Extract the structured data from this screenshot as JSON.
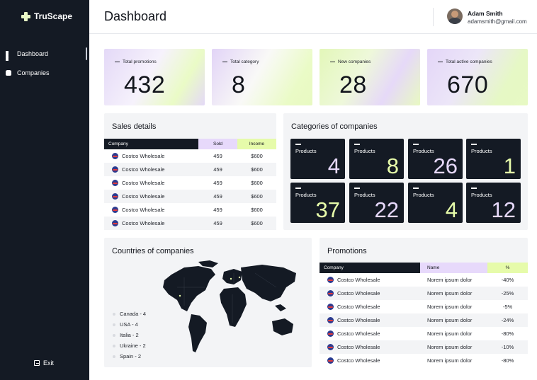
{
  "app": {
    "name": "TruScape"
  },
  "sidebar": {
    "items": [
      {
        "label": "Dashboard",
        "icon": "grid-icon"
      },
      {
        "label": "Companies",
        "icon": "database-icon"
      }
    ],
    "exit_label": "Exit"
  },
  "header": {
    "title": "Dashboard",
    "user": {
      "name": "Adam Smith",
      "email": "adamsmith@gmail.com"
    }
  },
  "stats": [
    {
      "label": "Total promotions",
      "value": "432"
    },
    {
      "label": "Total category",
      "value": "8"
    },
    {
      "label": "New companies",
      "value": "28"
    },
    {
      "label": "Total active companies",
      "value": "670"
    }
  ],
  "sales": {
    "title": "Sales details",
    "columns": [
      "Company",
      "Sold",
      "Income"
    ],
    "rows": [
      {
        "company": "Costco Wholesale",
        "sold": "459",
        "income": "$600"
      },
      {
        "company": "Costco Wholesale",
        "sold": "459",
        "income": "$600"
      },
      {
        "company": "Costco Wholesale",
        "sold": "459",
        "income": "$600"
      },
      {
        "company": "Costco Wholesale",
        "sold": "459",
        "income": "$600"
      },
      {
        "company": "Costco Wholesale",
        "sold": "459",
        "income": "$600"
      },
      {
        "company": "Costco Wholesale",
        "sold": "459",
        "income": "$600"
      }
    ]
  },
  "categories": {
    "title": "Categories of companies",
    "tiles": [
      {
        "label": "Products",
        "value": "4",
        "color": "#e7d9fb"
      },
      {
        "label": "Products",
        "value": "8",
        "color": "#e6fbaa"
      },
      {
        "label": "Products",
        "value": "26",
        "color": "#e7d9fb"
      },
      {
        "label": "Products",
        "value": "1",
        "color": "#e6fbaa"
      },
      {
        "label": "Products",
        "value": "37",
        "color": "#e6fbaa"
      },
      {
        "label": "Products",
        "value": "22",
        "color": "#e7d9fb"
      },
      {
        "label": "Products",
        "value": "4",
        "color": "#e6fbaa"
      },
      {
        "label": "Products",
        "value": "12",
        "color": "#e7d9fb"
      }
    ]
  },
  "countries": {
    "title": "Countries of companies",
    "legend": [
      "Canada - 4",
      "USA - 4",
      "Italia - 2",
      "Ukraine - 2",
      "Spain - 2"
    ]
  },
  "promotions": {
    "title": "Promotions",
    "columns": [
      "Company",
      "Name",
      "%"
    ],
    "rows": [
      {
        "company": "Costco Wholesale",
        "name": "Norem ipsum dolor",
        "pct": "-40%"
      },
      {
        "company": "Costco Wholesale",
        "name": "Norem ipsum dolor",
        "pct": "-25%"
      },
      {
        "company": "Costco Wholesale",
        "name": "Norem ipsum dolor",
        "pct": "-5%"
      },
      {
        "company": "Costco Wholesale",
        "name": "Norem ipsum dolor",
        "pct": "-24%"
      },
      {
        "company": "Costco Wholesale",
        "name": "Norem ipsum dolor",
        "pct": "-80%"
      },
      {
        "company": "Costco Wholesale",
        "name": "Norem ipsum dolor",
        "pct": "-10%"
      },
      {
        "company": "Costco Wholesale",
        "name": "Norem ipsum dolor",
        "pct": "-80%"
      }
    ]
  },
  "colors": {
    "sidebar": "#141a24",
    "accent_lilac": "#e7d9fb",
    "accent_lime": "#e6fbaa",
    "panel": "#f3f4f6"
  }
}
